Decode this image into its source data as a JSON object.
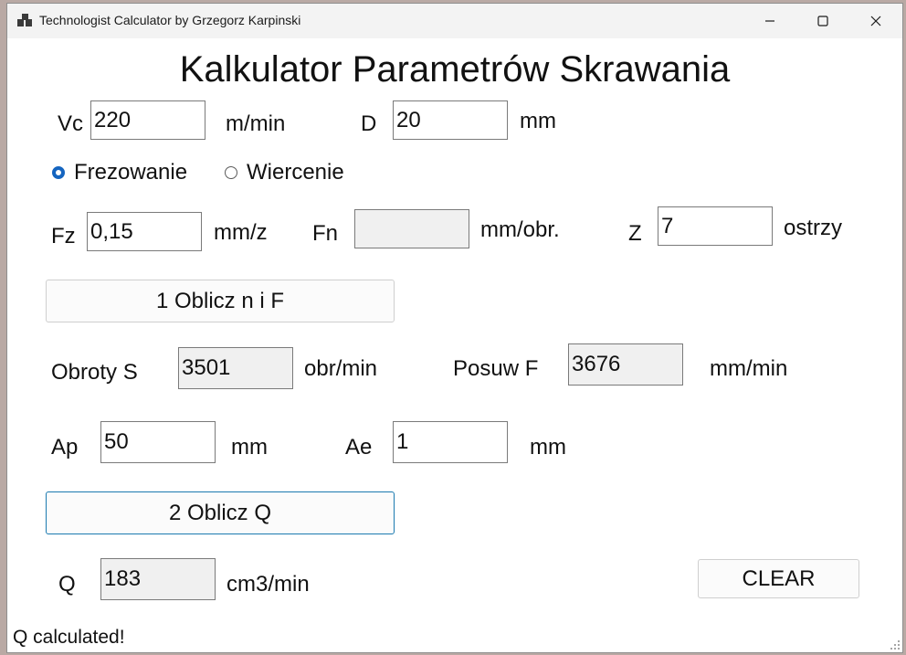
{
  "window": {
    "title": "Technologist Calculator by Grzegorz Karpinski"
  },
  "heading": "Kalkulator Parametrów Skrawania",
  "vc": {
    "label": "Vc",
    "value": "220",
    "unit": "m/min"
  },
  "d": {
    "label": "D",
    "value": "20",
    "unit": "mm"
  },
  "mode": {
    "options": [
      "Frezowanie",
      "Wiercenie"
    ],
    "selected": "Frezowanie"
  },
  "fz": {
    "label": "Fz",
    "value": "0,15",
    "unit": "mm/z"
  },
  "fn": {
    "label": "Fn",
    "value": "",
    "unit": "mm/obr."
  },
  "z": {
    "label": "Z",
    "value": "7",
    "unit": "ostrzy"
  },
  "buttons": {
    "calc_nf": "1 Oblicz n i F",
    "calc_q": "2 Oblicz Q",
    "clear": "CLEAR"
  },
  "speed": {
    "label": "Obroty S",
    "value": "3501",
    "unit": "obr/min"
  },
  "feed": {
    "label": "Posuw F",
    "value": "3676",
    "unit": "mm/min"
  },
  "ap": {
    "label": "Ap",
    "value": "50",
    "unit": "mm"
  },
  "ae": {
    "label": "Ae",
    "value": "1",
    "unit": "mm"
  },
  "q": {
    "label": "Q",
    "value": "183",
    "unit": "cm3/min"
  },
  "status": "Q calculated!",
  "colors": {
    "accent": "#1565c0",
    "focus_border": "#1b7ab0",
    "readonly_bg": "#f0f0f0"
  },
  "icons": {
    "app": "window-icon",
    "minimize": "minimize-icon",
    "maximize": "maximize-icon",
    "close": "close-icon",
    "resize": "resize-grip-icon"
  }
}
